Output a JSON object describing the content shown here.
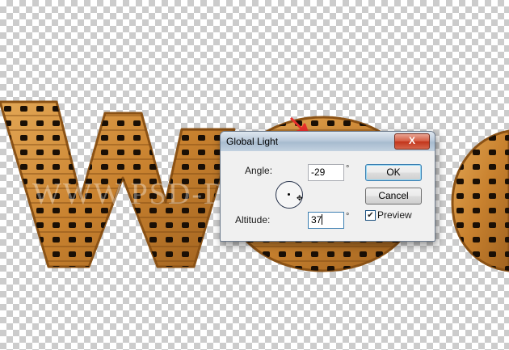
{
  "artwork": {
    "watermark": "WWW.PSD-DUDE.COM"
  },
  "dialog": {
    "title": "Global Light",
    "close_label": "X",
    "angle": {
      "label": "Angle:",
      "value": "-29",
      "unit": "°"
    },
    "altitude": {
      "label": "Altitude:",
      "value": "37",
      "unit": "°"
    },
    "ok_label": "OK",
    "cancel_label": "Cancel",
    "preview": {
      "label": "Preview",
      "checked": true,
      "check_glyph": "✔"
    }
  },
  "colors": {
    "wood": "#c9822f",
    "wood_dark": "#8b5215",
    "highlight_arrow": "#e8312c"
  },
  "icons": [
    "close-icon",
    "angle-dial-icon",
    "move-cursor-icon",
    "checkbox-check-icon",
    "red-arrow-icon"
  ]
}
